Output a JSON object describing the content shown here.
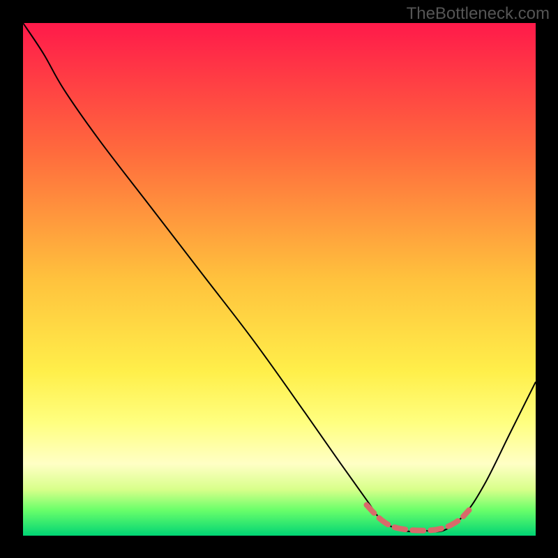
{
  "watermark": "TheBottleneck.com",
  "chart_data": {
    "type": "line",
    "title": "",
    "xlabel": "",
    "ylabel": "",
    "xlim": [
      0,
      100
    ],
    "ylim": [
      0,
      100
    ],
    "gradient_colors": [
      "#ff1a4a",
      "#ff7a3d",
      "#ffd23d",
      "#fff85a",
      "#3de06a"
    ],
    "gradient_bands": [
      {
        "color": "#ffff99",
        "y_start": 70,
        "y_end": 78
      },
      {
        "color": "#ffffc5",
        "y_start": 78,
        "y_end": 85
      },
      {
        "color": "#d8ff8a",
        "y_start": 85,
        "y_end": 92
      },
      {
        "color": "#6aff6a",
        "y_start": 92,
        "y_end": 96
      },
      {
        "color": "#00d474",
        "y_start": 96,
        "y_end": 100
      }
    ],
    "series": [
      {
        "name": "bottleneck-curve",
        "color": "#000000",
        "stroke_width": 2,
        "points": [
          {
            "x": 0,
            "y": 0
          },
          {
            "x": 4,
            "y": 6
          },
          {
            "x": 8,
            "y": 13
          },
          {
            "x": 15,
            "y": 23
          },
          {
            "x": 25,
            "y": 36
          },
          {
            "x": 35,
            "y": 49
          },
          {
            "x": 45,
            "y": 62
          },
          {
            "x": 55,
            "y": 76
          },
          {
            "x": 62,
            "y": 86
          },
          {
            "x": 67,
            "y": 93
          },
          {
            "x": 70,
            "y": 97
          },
          {
            "x": 74,
            "y": 99
          },
          {
            "x": 78,
            "y": 99
          },
          {
            "x": 82,
            "y": 99
          },
          {
            "x": 86,
            "y": 96
          },
          {
            "x": 90,
            "y": 90
          },
          {
            "x": 95,
            "y": 80
          },
          {
            "x": 100,
            "y": 70
          }
        ]
      },
      {
        "name": "valley-highlight",
        "color": "#d86a6a",
        "stroke_width": 8,
        "dash": "16 10",
        "points": [
          {
            "x": 67,
            "y": 94
          },
          {
            "x": 70,
            "y": 97
          },
          {
            "x": 73,
            "y": 98.5
          },
          {
            "x": 78,
            "y": 99
          },
          {
            "x": 82,
            "y": 98.5
          },
          {
            "x": 85,
            "y": 97
          },
          {
            "x": 87,
            "y": 95
          }
        ]
      }
    ]
  }
}
